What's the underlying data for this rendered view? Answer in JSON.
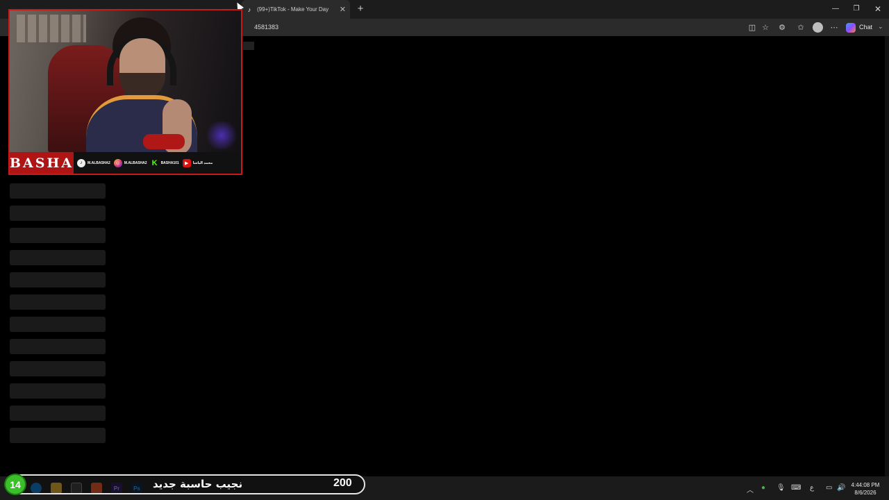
{
  "browser": {
    "tabs": [
      {
        "title": "",
        "active": false
      },
      {
        "title": "",
        "active": false
      },
      {
        "title": "(99+)TikTok - Make Your Day",
        "active": true
      }
    ],
    "url_fragment": "4581383",
    "chat_label": "Chat",
    "window_controls": {
      "minimize": "—",
      "maximize": "❐",
      "close": "✕"
    }
  },
  "webcam": {
    "brand": "BASHA",
    "socials": [
      {
        "icon": "tiktok-icon",
        "handle": "M.ALBASHA2"
      },
      {
        "icon": "instagram-icon",
        "handle": "M.ALBASHA2"
      },
      {
        "icon": "kick-icon",
        "handle": "BASHA101"
      },
      {
        "icon": "youtube-icon",
        "handle": "محمد الباشا"
      }
    ]
  },
  "overlay": {
    "goal_count": "14",
    "goal_text": "نجيب حاسبة جديد",
    "goal_target": "200"
  },
  "taskbar": {
    "apps": [
      "edge-icon",
      "file-explorer-icon",
      "store-icon",
      "brave-icon",
      "premiere-icon",
      "photoshop-icon"
    ],
    "time": "4:44:08 PM",
    "date": "8/6/2026",
    "lang": "ع"
  },
  "colors": {
    "accent_red": "#c81a1a",
    "goal_green": "#3bbf2a"
  }
}
